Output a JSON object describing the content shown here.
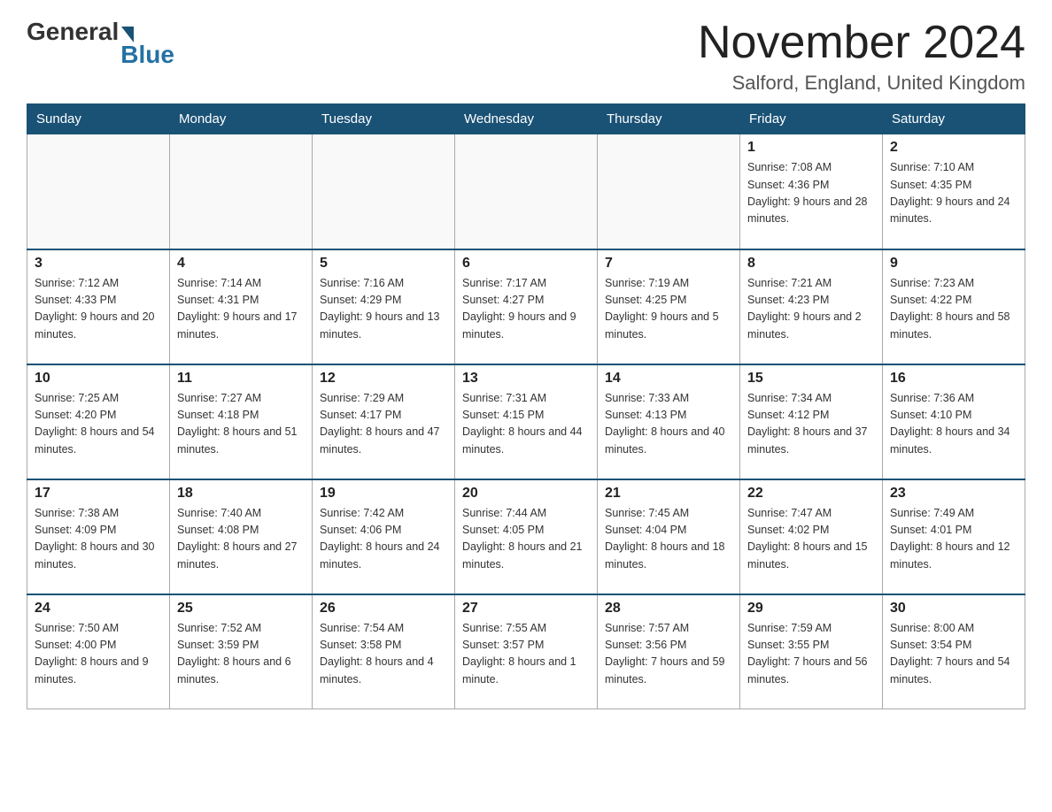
{
  "header": {
    "logo_general": "General",
    "logo_blue": "Blue",
    "month_title": "November 2024",
    "location": "Salford, England, United Kingdom"
  },
  "days_of_week": [
    "Sunday",
    "Monday",
    "Tuesday",
    "Wednesday",
    "Thursday",
    "Friday",
    "Saturday"
  ],
  "weeks": [
    [
      {
        "day": "",
        "sunrise": "",
        "sunset": "",
        "daylight": ""
      },
      {
        "day": "",
        "sunrise": "",
        "sunset": "",
        "daylight": ""
      },
      {
        "day": "",
        "sunrise": "",
        "sunset": "",
        "daylight": ""
      },
      {
        "day": "",
        "sunrise": "",
        "sunset": "",
        "daylight": ""
      },
      {
        "day": "",
        "sunrise": "",
        "sunset": "",
        "daylight": ""
      },
      {
        "day": "1",
        "sunrise": "Sunrise: 7:08 AM",
        "sunset": "Sunset: 4:36 PM",
        "daylight": "Daylight: 9 hours and 28 minutes."
      },
      {
        "day": "2",
        "sunrise": "Sunrise: 7:10 AM",
        "sunset": "Sunset: 4:35 PM",
        "daylight": "Daylight: 9 hours and 24 minutes."
      }
    ],
    [
      {
        "day": "3",
        "sunrise": "Sunrise: 7:12 AM",
        "sunset": "Sunset: 4:33 PM",
        "daylight": "Daylight: 9 hours and 20 minutes."
      },
      {
        "day": "4",
        "sunrise": "Sunrise: 7:14 AM",
        "sunset": "Sunset: 4:31 PM",
        "daylight": "Daylight: 9 hours and 17 minutes."
      },
      {
        "day": "5",
        "sunrise": "Sunrise: 7:16 AM",
        "sunset": "Sunset: 4:29 PM",
        "daylight": "Daylight: 9 hours and 13 minutes."
      },
      {
        "day": "6",
        "sunrise": "Sunrise: 7:17 AM",
        "sunset": "Sunset: 4:27 PM",
        "daylight": "Daylight: 9 hours and 9 minutes."
      },
      {
        "day": "7",
        "sunrise": "Sunrise: 7:19 AM",
        "sunset": "Sunset: 4:25 PM",
        "daylight": "Daylight: 9 hours and 5 minutes."
      },
      {
        "day": "8",
        "sunrise": "Sunrise: 7:21 AM",
        "sunset": "Sunset: 4:23 PM",
        "daylight": "Daylight: 9 hours and 2 minutes."
      },
      {
        "day": "9",
        "sunrise": "Sunrise: 7:23 AM",
        "sunset": "Sunset: 4:22 PM",
        "daylight": "Daylight: 8 hours and 58 minutes."
      }
    ],
    [
      {
        "day": "10",
        "sunrise": "Sunrise: 7:25 AM",
        "sunset": "Sunset: 4:20 PM",
        "daylight": "Daylight: 8 hours and 54 minutes."
      },
      {
        "day": "11",
        "sunrise": "Sunrise: 7:27 AM",
        "sunset": "Sunset: 4:18 PM",
        "daylight": "Daylight: 8 hours and 51 minutes."
      },
      {
        "day": "12",
        "sunrise": "Sunrise: 7:29 AM",
        "sunset": "Sunset: 4:17 PM",
        "daylight": "Daylight: 8 hours and 47 minutes."
      },
      {
        "day": "13",
        "sunrise": "Sunrise: 7:31 AM",
        "sunset": "Sunset: 4:15 PM",
        "daylight": "Daylight: 8 hours and 44 minutes."
      },
      {
        "day": "14",
        "sunrise": "Sunrise: 7:33 AM",
        "sunset": "Sunset: 4:13 PM",
        "daylight": "Daylight: 8 hours and 40 minutes."
      },
      {
        "day": "15",
        "sunrise": "Sunrise: 7:34 AM",
        "sunset": "Sunset: 4:12 PM",
        "daylight": "Daylight: 8 hours and 37 minutes."
      },
      {
        "day": "16",
        "sunrise": "Sunrise: 7:36 AM",
        "sunset": "Sunset: 4:10 PM",
        "daylight": "Daylight: 8 hours and 34 minutes."
      }
    ],
    [
      {
        "day": "17",
        "sunrise": "Sunrise: 7:38 AM",
        "sunset": "Sunset: 4:09 PM",
        "daylight": "Daylight: 8 hours and 30 minutes."
      },
      {
        "day": "18",
        "sunrise": "Sunrise: 7:40 AM",
        "sunset": "Sunset: 4:08 PM",
        "daylight": "Daylight: 8 hours and 27 minutes."
      },
      {
        "day": "19",
        "sunrise": "Sunrise: 7:42 AM",
        "sunset": "Sunset: 4:06 PM",
        "daylight": "Daylight: 8 hours and 24 minutes."
      },
      {
        "day": "20",
        "sunrise": "Sunrise: 7:44 AM",
        "sunset": "Sunset: 4:05 PM",
        "daylight": "Daylight: 8 hours and 21 minutes."
      },
      {
        "day": "21",
        "sunrise": "Sunrise: 7:45 AM",
        "sunset": "Sunset: 4:04 PM",
        "daylight": "Daylight: 8 hours and 18 minutes."
      },
      {
        "day": "22",
        "sunrise": "Sunrise: 7:47 AM",
        "sunset": "Sunset: 4:02 PM",
        "daylight": "Daylight: 8 hours and 15 minutes."
      },
      {
        "day": "23",
        "sunrise": "Sunrise: 7:49 AM",
        "sunset": "Sunset: 4:01 PM",
        "daylight": "Daylight: 8 hours and 12 minutes."
      }
    ],
    [
      {
        "day": "24",
        "sunrise": "Sunrise: 7:50 AM",
        "sunset": "Sunset: 4:00 PM",
        "daylight": "Daylight: 8 hours and 9 minutes."
      },
      {
        "day": "25",
        "sunrise": "Sunrise: 7:52 AM",
        "sunset": "Sunset: 3:59 PM",
        "daylight": "Daylight: 8 hours and 6 minutes."
      },
      {
        "day": "26",
        "sunrise": "Sunrise: 7:54 AM",
        "sunset": "Sunset: 3:58 PM",
        "daylight": "Daylight: 8 hours and 4 minutes."
      },
      {
        "day": "27",
        "sunrise": "Sunrise: 7:55 AM",
        "sunset": "Sunset: 3:57 PM",
        "daylight": "Daylight: 8 hours and 1 minute."
      },
      {
        "day": "28",
        "sunrise": "Sunrise: 7:57 AM",
        "sunset": "Sunset: 3:56 PM",
        "daylight": "Daylight: 7 hours and 59 minutes."
      },
      {
        "day": "29",
        "sunrise": "Sunrise: 7:59 AM",
        "sunset": "Sunset: 3:55 PM",
        "daylight": "Daylight: 7 hours and 56 minutes."
      },
      {
        "day": "30",
        "sunrise": "Sunrise: 8:00 AM",
        "sunset": "Sunset: 3:54 PM",
        "daylight": "Daylight: 7 hours and 54 minutes."
      }
    ]
  ]
}
